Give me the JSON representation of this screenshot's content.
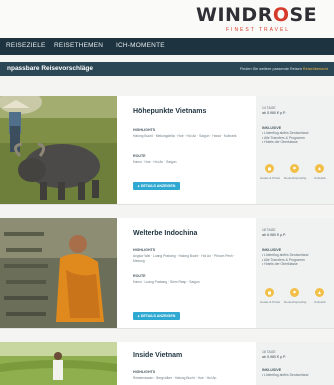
{
  "brand": {
    "name_left": "WINDR",
    "name_accent": "O",
    "name_right": "SE",
    "tagline": "FINEST TRAVEL"
  },
  "nav": {
    "items": [
      "REISEZIELE",
      "REISETHEMEN",
      "ICH-MOMENTE"
    ]
  },
  "section": {
    "title": "npassbare Reisevorschläge",
    "right_text": "Finden Sie weitere passende Reisen",
    "right_link": "Reiseübersicht"
  },
  "colors": {
    "navy": "#1e3340",
    "teal_header": "#2b4756",
    "button": "#2fa9d2",
    "feature": "#f2bf49",
    "logo_accent": "#d63a2a"
  },
  "cards": [
    {
      "title": "Höhepunkte Vietnams",
      "label_a": "HIGHLIGHTS",
      "text_a": "Halong Bucht · Mekongdelta · Hue · Hoi An · Saigon · Hanoi · Kulinarik",
      "label_b": "ROUTE",
      "text_b": "Hanoi · Hue · Hoi An · Saigon",
      "button": "▸ DETAILS ANZEIGEN",
      "duration": "14 TAGE",
      "price": "ab 5.980 € p.P.",
      "inc_label": "INKLUSIVE",
      "inc_items": [
        "• Linienflug ab/bis Deutschland",
        "• Alle Transfers & Programm",
        "• Hotels der Oberklasse"
      ],
      "features": [
        "Hotels & Privat",
        "Deutschsprachig",
        "Kulinarik"
      ]
    },
    {
      "title": "Welterbe Indochina",
      "label_a": "HIGHLIGHTS",
      "text_a": "Angkor Wat · Luang Prabang · Halong Bucht · Hoi An · Phnom Penh · Mekong",
      "label_b": "ROUTE",
      "text_b": "Hanoi · Luang Prabang · Siem Reap · Saigon",
      "button": "▸ DETAILS ANZEIGEN",
      "duration": "18 TAGE",
      "price": "ab 6.980 € p.P.",
      "inc_label": "INKLUSIVE",
      "inc_items": [
        "• Linienflug ab/bis Deutschland",
        "• Alle Transfers & Programm",
        "• Hotels der Oberklasse"
      ],
      "features": [
        "Hotels & Privat",
        "Deutschsprachig",
        "Kulinarik"
      ]
    },
    {
      "title": "Inside Vietnam",
      "label_a": "HIGHLIGHTS",
      "text_a": "Reisterrassen · Bergvölker · Halong Bucht · Hue · Hoi An",
      "duration": "16 TAGE",
      "price": "ab 5.980 € p.P.",
      "inc_label": "INKLUSIVE",
      "inc_items": [
        "• Linienflug ab/bis Deutschland"
      ]
    }
  ]
}
